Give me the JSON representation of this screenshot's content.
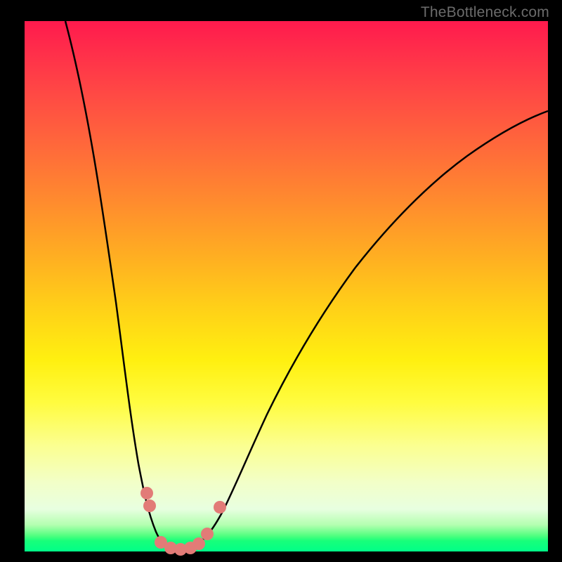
{
  "watermark": "TheBottleneck.com",
  "colors": {
    "curve_stroke": "#000000",
    "marker_fill": "#e27b77",
    "frame": "#000000"
  },
  "chart_data": {
    "type": "line",
    "title": "",
    "xlabel": "",
    "ylabel": "",
    "xlim": [
      0,
      1
    ],
    "ylim": [
      0,
      100
    ],
    "x": [
      0.0,
      0.05,
      0.1,
      0.15,
      0.18,
      0.2,
      0.22,
      0.24,
      0.26,
      0.28,
      0.3,
      0.32,
      0.34,
      0.36,
      0.4,
      0.45,
      0.5,
      0.55,
      0.6,
      0.65,
      0.7,
      0.75,
      0.8,
      0.85,
      0.9,
      0.95,
      1.0
    ],
    "values": [
      100,
      85,
      68,
      47,
      32,
      20,
      10,
      3,
      0,
      0,
      0,
      2,
      8,
      16,
      30,
      43,
      53,
      60,
      66,
      71,
      75,
      78,
      80,
      82,
      83,
      84,
      85
    ],
    "markers": {
      "x": [
        0.205,
        0.215,
        0.235,
        0.255,
        0.275,
        0.295,
        0.305,
        0.32,
        0.33
      ],
      "y": [
        14,
        10,
        2,
        0,
        0,
        0,
        2,
        6,
        10
      ]
    },
    "gradient_stops": [
      {
        "pos": 0.0,
        "color": "#ff1a4d"
      },
      {
        "pos": 0.34,
        "color": "#ff8b2e"
      },
      {
        "pos": 0.64,
        "color": "#fff010"
      },
      {
        "pos": 0.92,
        "color": "#e8ffe0"
      },
      {
        "pos": 1.0,
        "color": "#00ff88"
      }
    ]
  }
}
